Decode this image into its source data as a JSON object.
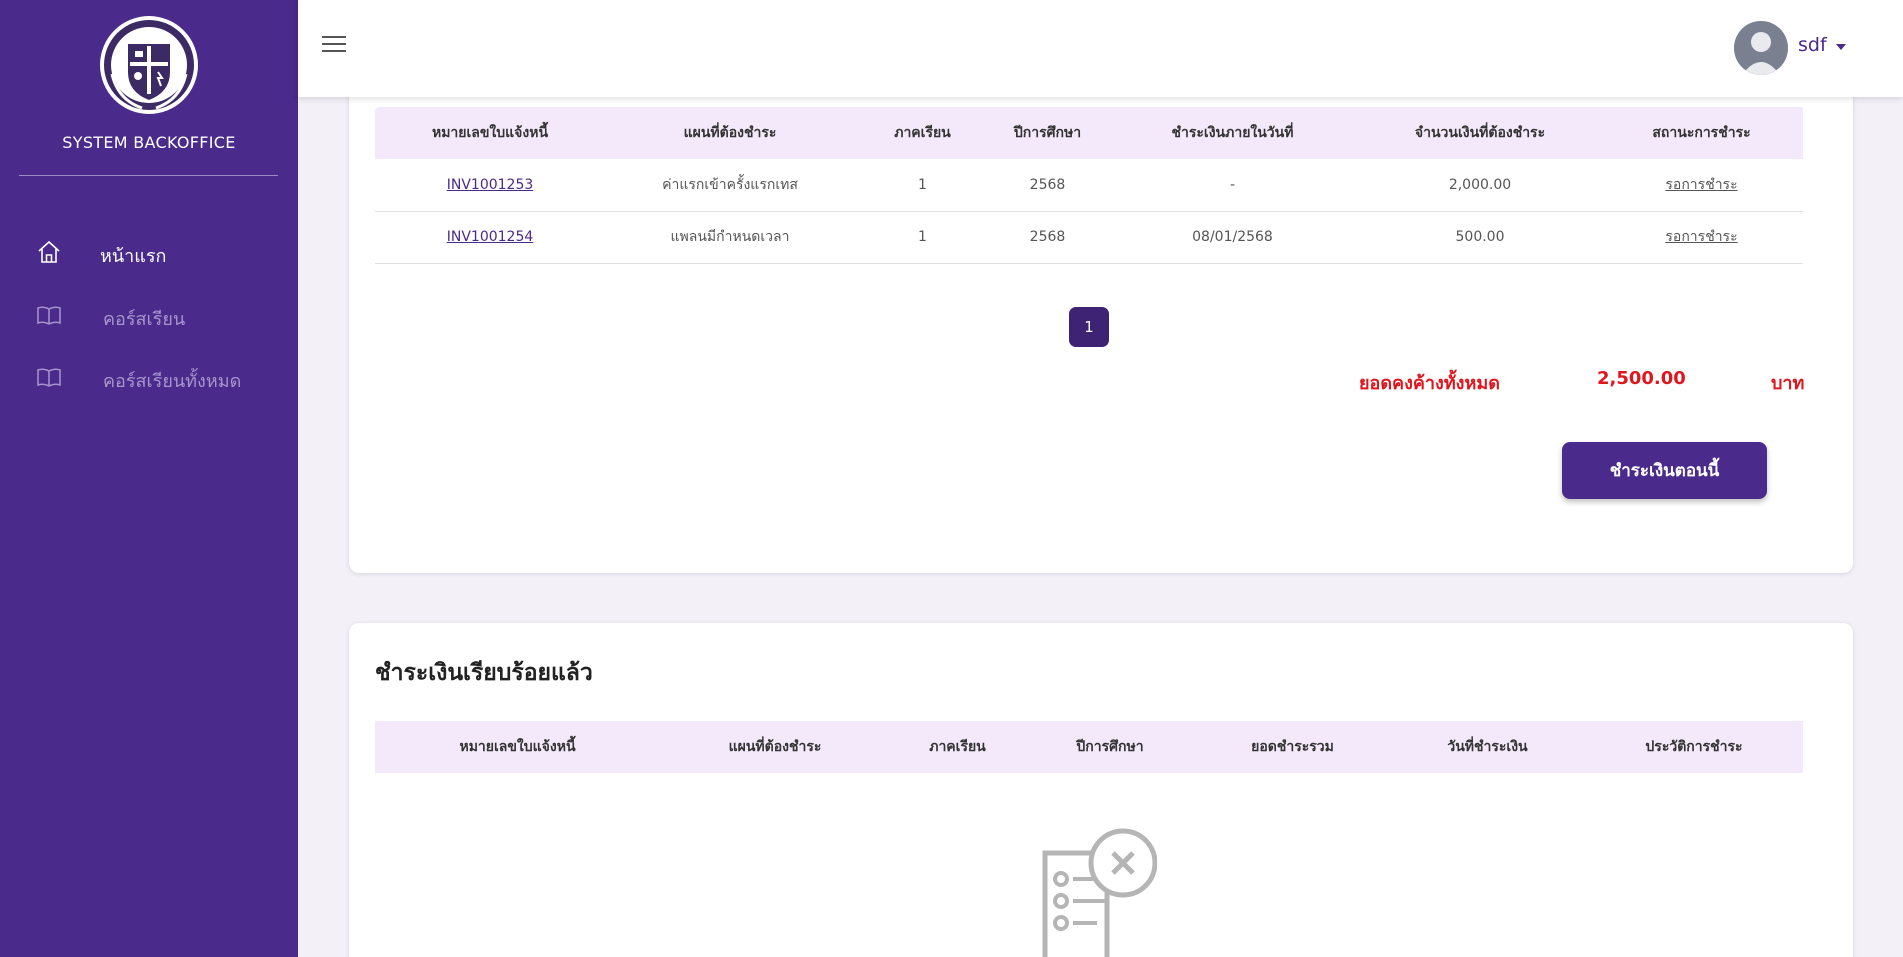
{
  "sidebar": {
    "brand": "SYSTEM BACKOFFICE",
    "logo_icon": "crest-logo",
    "items": [
      {
        "label": "หน้าแรก",
        "icon": "home-icon",
        "active": true
      },
      {
        "label": "คอร์สเรียน",
        "icon": "book-icon",
        "active": false
      },
      {
        "label": "คอร์สเรียนทั้งหมด",
        "icon": "book-icon",
        "active": false
      }
    ]
  },
  "header": {
    "user_name": "sdf"
  },
  "outstanding": {
    "columns": [
      "หมายเลขใบแจ้งหนี้",
      "แผนที่ต้องชำระ",
      "ภาคเรียน",
      "ปีการศึกษา",
      "ชำระเงินภายในวันที่",
      "จำนวนเงินที่ต้องชำระ",
      "สถานะการชำระ"
    ],
    "rows": [
      {
        "invoice": "INV1001253",
        "plan": "ค่าแรกเข้าครั้งแรกเทส",
        "term": "1",
        "year": "2568",
        "due": "-",
        "amount": "2,000.00",
        "status": "รอการชำระ"
      },
      {
        "invoice": "INV1001254",
        "plan": "แพลนมีกำหนดเวลา",
        "term": "1",
        "year": "2568",
        "due": "08/01/2568",
        "amount": "500.00",
        "status": "รอการชำระ"
      }
    ],
    "page": "1",
    "total_label": "ยอดคงค้างทั้งหมด",
    "total_value": "2,500.00",
    "total_unit": "บาท",
    "pay_button": "ชำระเงินตอนนี้"
  },
  "paid": {
    "title": "ชำระเงินเรียบร้อยแล้ว",
    "columns": [
      "หมายเลขใบแจ้งหนี้",
      "แผนที่ต้องชำระ",
      "ภาคเรียน",
      "ปีการศึกษา",
      "ยอดชำระรวม",
      "วันที่ชำระเงิน",
      "ประวัติการชำระ"
    ],
    "empty_icon": "no-document-icon"
  },
  "colors": {
    "sidebar": "#4a2a8a",
    "accent": "#4a2a8a",
    "table_header": "#f3e9fb",
    "danger": "#e0161e",
    "page_bg": "#f3f0f8"
  }
}
